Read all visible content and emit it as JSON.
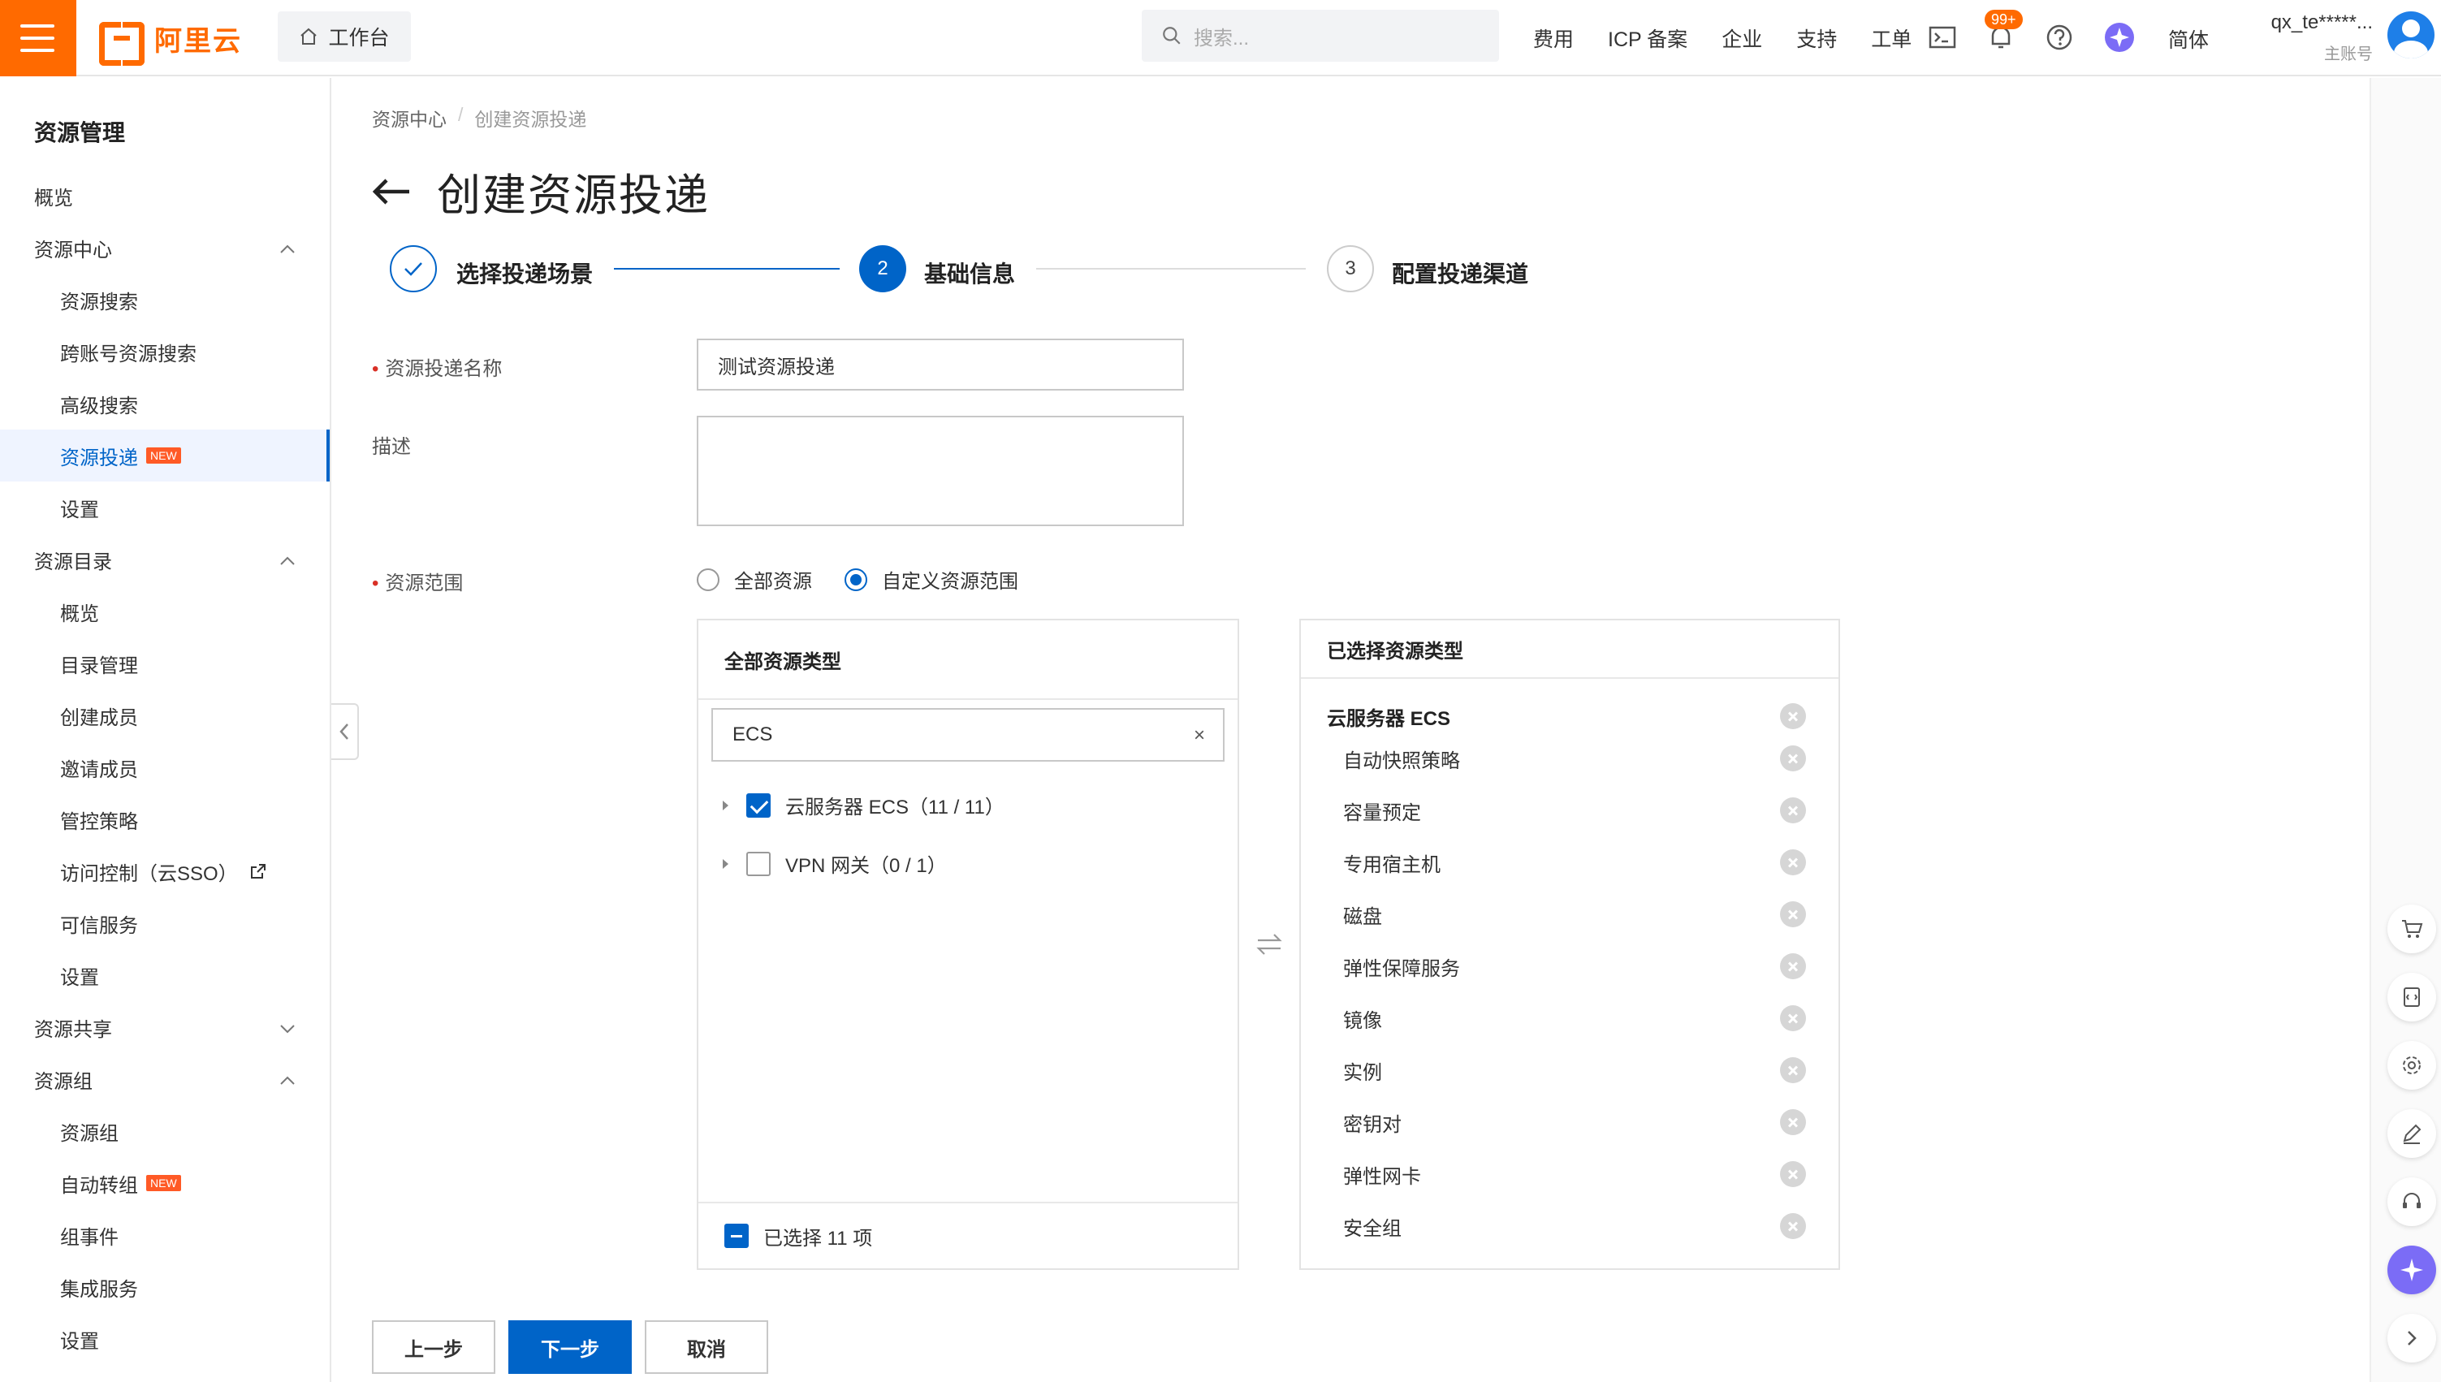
{
  "brand": {
    "logo_text": "阿里云",
    "accent": "#ff6a00"
  },
  "topbar": {
    "workbench": "工作台",
    "search_placeholder": "搜索...",
    "links": [
      "费用",
      "ICP 备案",
      "企业",
      "支持",
      "工单"
    ],
    "notification_badge": "99+",
    "language": "简体",
    "user_name": "qx_te*****...",
    "user_role": "主账号"
  },
  "sidebar": {
    "title": "资源管理",
    "items": [
      {
        "label": "概览",
        "level": 1
      },
      {
        "label": "资源中心",
        "level": 1,
        "expanded": true
      },
      {
        "label": "资源搜索",
        "level": 2
      },
      {
        "label": "跨账号资源搜索",
        "level": 2
      },
      {
        "label": "高级搜索",
        "level": 2
      },
      {
        "label": "资源投递",
        "level": 2,
        "active": true,
        "tag": "NEW"
      },
      {
        "label": "设置",
        "level": 2
      },
      {
        "label": "资源目录",
        "level": 1,
        "expanded": true
      },
      {
        "label": "概览",
        "level": 2
      },
      {
        "label": "目录管理",
        "level": 2
      },
      {
        "label": "创建成员",
        "level": 2
      },
      {
        "label": "邀请成员",
        "level": 2
      },
      {
        "label": "管控策略",
        "level": 2
      },
      {
        "label": "访问控制（云SSO）",
        "level": 2,
        "external": true
      },
      {
        "label": "可信服务",
        "level": 2
      },
      {
        "label": "设置",
        "level": 2
      },
      {
        "label": "资源共享",
        "level": 1,
        "expanded": false
      },
      {
        "label": "资源组",
        "level": 1,
        "expanded": true
      },
      {
        "label": "资源组",
        "level": 2
      },
      {
        "label": "自动转组",
        "level": 2,
        "tag": "NEW"
      },
      {
        "label": "组事件",
        "level": 2
      },
      {
        "label": "集成服务",
        "level": 2
      },
      {
        "label": "设置",
        "level": 2
      }
    ]
  },
  "breadcrumb": {
    "parent": "资源中心",
    "separator": "/",
    "current": "创建资源投递"
  },
  "page": {
    "title": "创建资源投递"
  },
  "steps": [
    {
      "index": "1",
      "label": "选择投递场景",
      "state": "done"
    },
    {
      "index": "2",
      "label": "基础信息",
      "state": "current"
    },
    {
      "index": "3",
      "label": "配置投递渠道",
      "state": "pending"
    }
  ],
  "form": {
    "name_label": "资源投递名称",
    "name_value": "测试资源投递",
    "desc_label": "描述",
    "desc_value": "",
    "scope_label": "资源范围",
    "scope_options": [
      "全部资源",
      "自定义资源范围"
    ],
    "scope_selected": "自定义资源范围"
  },
  "left_panel": {
    "title": "全部资源类型",
    "search_value": "ECS",
    "clear_glyph": "×",
    "tree": [
      {
        "label": "云服务器 ECS（11 / 11）",
        "checked": true
      },
      {
        "label": "VPN 网关（0 / 1）",
        "checked": false
      }
    ],
    "footer": "已选择 11 项"
  },
  "right_panel": {
    "title": "已选择资源类型",
    "group": "云服务器 ECS",
    "items": [
      "自动快照策略",
      "容量预定",
      "专用宿主机",
      "磁盘",
      "弹性保障服务",
      "镜像",
      "实例",
      "密钥对",
      "弹性网卡",
      "安全组"
    ]
  },
  "buttons": {
    "prev": "上一步",
    "next": "下一步",
    "cancel": "取消"
  },
  "colors": {
    "primary": "#0064c8",
    "danger": "#d93026",
    "new_tag": "#ff5a26"
  }
}
